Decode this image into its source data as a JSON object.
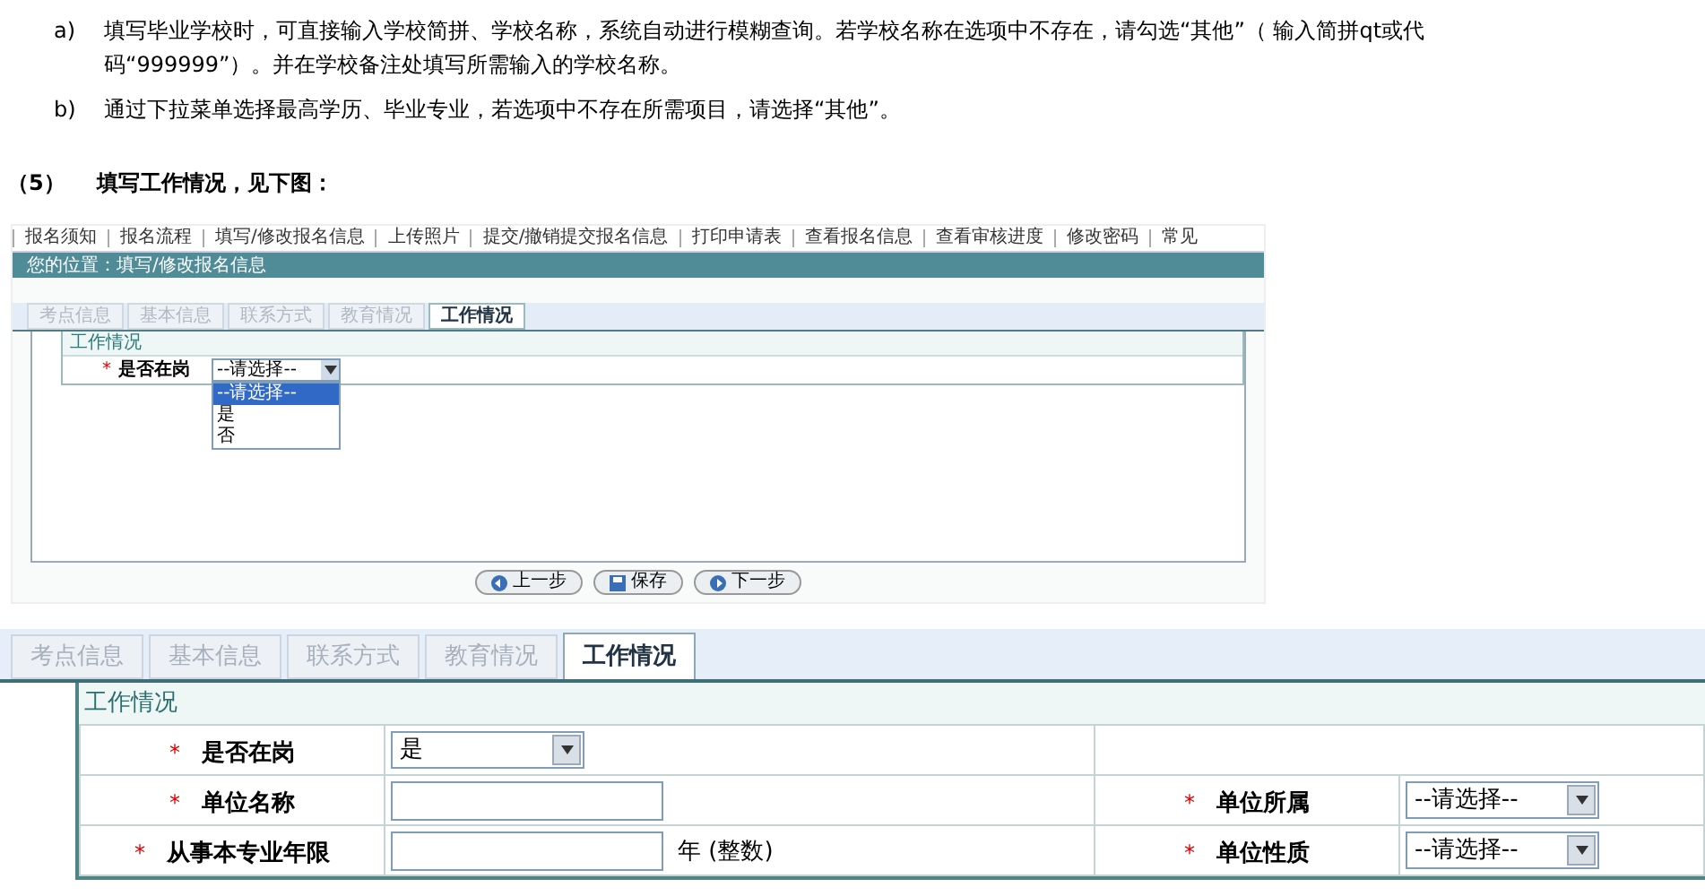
{
  "instructions": [
    {
      "marker": "a)",
      "text": "填写毕业学校时，可直接输入学校简拼、学校名称，系统自动进行模糊查询。若学校名称在选项中不存在，请勾选“其他”（ 输入简拼qt或代码“999999”）。并在学校备注处填写所需输入的学校名称。"
    },
    {
      "marker": "b)",
      "text": "通过下拉菜单选择最高学历、毕业专业，若选项中不存在所需项目，请选择“其他”。"
    }
  ],
  "step": {
    "number": "（5）",
    "text": "填写工作情况，见下图："
  },
  "screenshot": {
    "nav": [
      "报名须知",
      "报名流程",
      "填写/修改报名信息",
      "上传照片",
      "提交/撤销提交报名信息",
      "打印申请表",
      "查看报名信息",
      "查看审核进度",
      "修改密码",
      "常见"
    ],
    "breadcrumb": "您的位置：填写/修改报名信息",
    "tabs": [
      {
        "label": "考点信息",
        "selected": false
      },
      {
        "label": "基本信息",
        "selected": false
      },
      {
        "label": "联系方式",
        "selected": false
      },
      {
        "label": "教育情况",
        "selected": false
      },
      {
        "label": "工作情况",
        "selected": true
      }
    ],
    "section_title": "工作情况",
    "field": {
      "mark": "*",
      "label": "是否在岗",
      "value": "--请选择--",
      "options": [
        {
          "label": "--请选择--",
          "selected": true
        },
        {
          "label": "是",
          "selected": false
        },
        {
          "label": "否",
          "selected": false
        }
      ]
    },
    "buttons": [
      {
        "kind": "back",
        "label": "上一步"
      },
      {
        "kind": "save",
        "label": "保存"
      },
      {
        "kind": "next",
        "label": "下一步"
      }
    ]
  },
  "form": {
    "tabs": [
      {
        "label": "考点信息",
        "selected": false
      },
      {
        "label": "基本信息",
        "selected": false
      },
      {
        "label": "联系方式",
        "selected": false
      },
      {
        "label": "教育情况",
        "selected": false
      },
      {
        "label": "工作情况",
        "selected": true
      }
    ],
    "section_title": "工作情况",
    "rows": [
      [
        {
          "mark": "*",
          "label": "是否在岗",
          "kind": "select",
          "value": "是"
        }
      ],
      [
        {
          "mark": "*",
          "label": "单位名称",
          "kind": "input"
        },
        {
          "mark": "*",
          "label": "单位所属",
          "kind": "select",
          "value": "--请选择--"
        }
      ],
      [
        {
          "mark": "*",
          "label": "从事本专业年限",
          "kind": "input",
          "suffix": "年 (整数)"
        },
        {
          "mark": "*",
          "label": "单位性质",
          "kind": "select",
          "value": "--请选择--"
        }
      ]
    ]
  }
}
